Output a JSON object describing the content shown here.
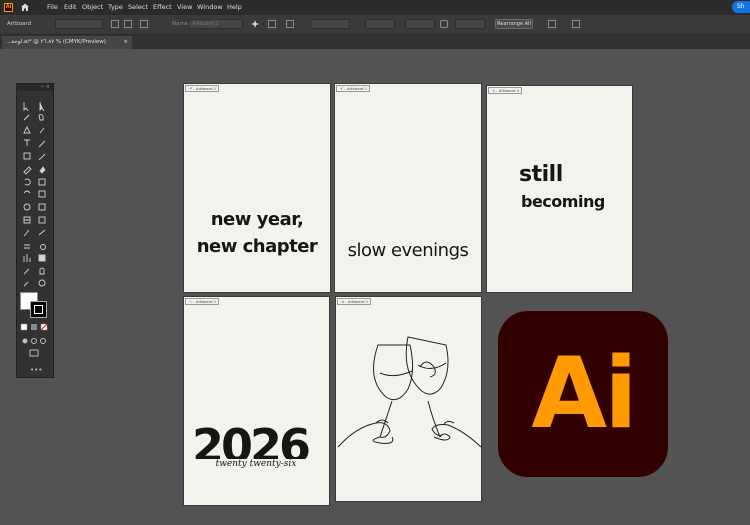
{
  "app": {
    "logo_text": "Ai"
  },
  "menu": {
    "items": [
      "File",
      "Edit",
      "Object",
      "Type",
      "Select",
      "Effect",
      "View",
      "Window",
      "Help"
    ],
    "share_label": "Sh"
  },
  "control_bar": {
    "label": "Artboard",
    "name_label": "Name:",
    "name_value": "Artboard 1",
    "rearrange_label": "Rearrange All"
  },
  "document_tab": {
    "title": "...لوحة.ai* @ ٢٦.٨٧ % (CMYK/Preview)",
    "close": "×"
  },
  "artboards": [
    {
      "label": "٠٣ - Artboard 1",
      "text_lines": [
        "new year,",
        "new chapter"
      ]
    },
    {
      "label": "٠٢ - Artboard 1",
      "text_lines": [
        "slow evenings"
      ]
    },
    {
      "label": "٠٤ - Artboard 1",
      "text_lines": [
        "still",
        "becoming"
      ]
    },
    {
      "label": "٠١ - Artboard 1",
      "big_text": "2026",
      "script_text": "twenty twenty-six"
    },
    {
      "label": "٠٥ - Artboard 1",
      "illustration": "wine-glasses-toast"
    }
  ],
  "ai_logo": {
    "text": "Ai",
    "colors": {
      "background": "#330000",
      "foreground": "#ff9a00"
    }
  },
  "colors": {
    "canvas": "#535353",
    "artboard": "#f3f2ed",
    "share": "#1473e6"
  }
}
